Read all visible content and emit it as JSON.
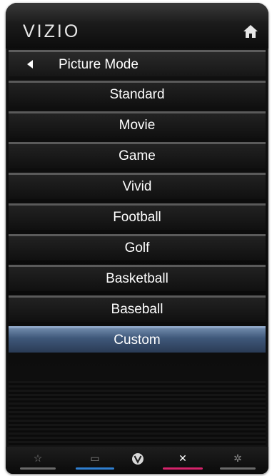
{
  "brand": {
    "logo_text": "VIZIO"
  },
  "header": {
    "home_icon": "home-icon"
  },
  "menu": {
    "title": "Picture Mode",
    "items": [
      {
        "label": "Standard",
        "selected": false
      },
      {
        "label": "Movie",
        "selected": false
      },
      {
        "label": "Game",
        "selected": false
      },
      {
        "label": "Vivid",
        "selected": false
      },
      {
        "label": "Football",
        "selected": false
      },
      {
        "label": "Golf",
        "selected": false
      },
      {
        "label": "Basketball",
        "selected": false
      },
      {
        "label": "Baseball",
        "selected": false
      },
      {
        "label": "Custom",
        "selected": true
      }
    ]
  },
  "bottom_bar": {
    "buttons": [
      {
        "icon": "star-icon",
        "glyph": "☆",
        "color": "#6a6a6a"
      },
      {
        "icon": "input-icon",
        "glyph": "▭",
        "color": "#2f7fd1"
      },
      {
        "icon": "vizio-v-icon",
        "glyph": "V",
        "color": "#6a6a6a"
      },
      {
        "icon": "close-icon",
        "glyph": "✕",
        "color": "#d6236b"
      },
      {
        "icon": "settings-icon",
        "glyph": "✲",
        "color": "#6a6a6a"
      }
    ]
  },
  "colors": {
    "selected_highlight": "#4a6488",
    "text": "#ffffff",
    "separator": "#5a5a5a"
  }
}
